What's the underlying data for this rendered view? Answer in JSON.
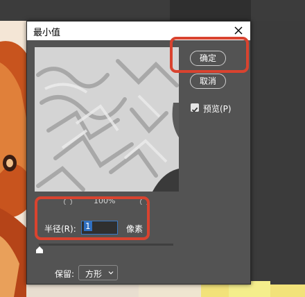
{
  "dialog": {
    "title": "最小值",
    "zoom_level": "100%",
    "ok_label": "确定",
    "cancel_label": "取消",
    "preview_label": "预览(P)",
    "preview_checked": true,
    "radius_label": "半径(R):",
    "radius_value": "1",
    "radius_unit": "像素",
    "keep_label": "保留:",
    "keep_value": "方形"
  },
  "colors": {
    "dialog_bg": "#535353",
    "highlight": "#d9432f",
    "input_focus": "#3a79c4"
  },
  "icons": [
    "close-icon",
    "zoom-out-icon",
    "zoom-in-icon",
    "check-icon",
    "slider-thumb-icon",
    "chevron-down-icon"
  ]
}
